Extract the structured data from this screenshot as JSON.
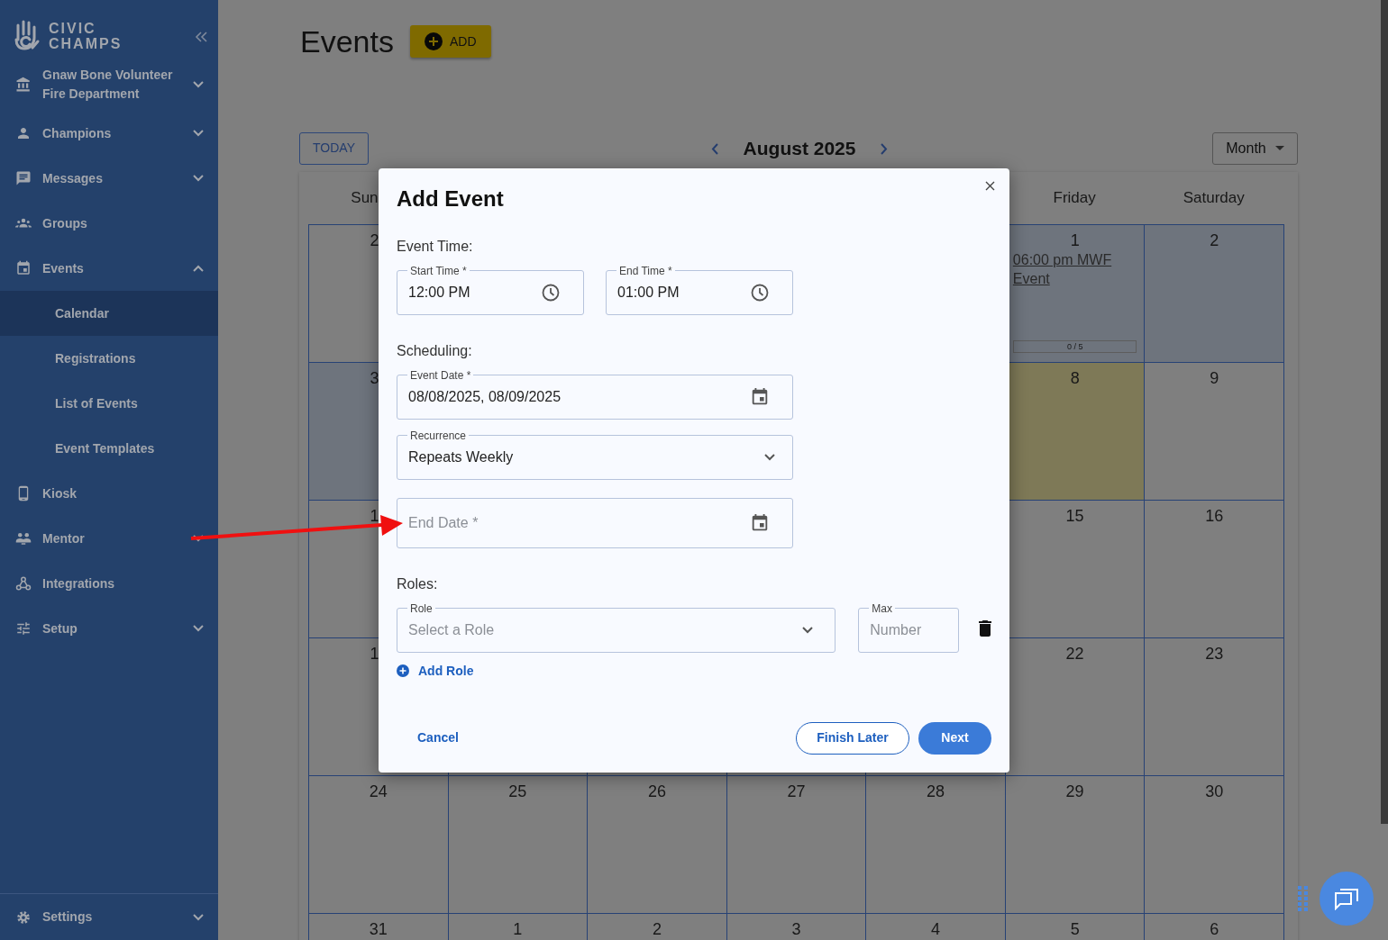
{
  "sidebar": {
    "brand": [
      "CIVIC",
      "CHAMPS"
    ],
    "items": [
      {
        "label": "Gnaw Bone Volunteer Fire Department",
        "expanded": false
      },
      {
        "label": "Champions",
        "expanded": false
      },
      {
        "label": "Messages",
        "expanded": false
      },
      {
        "label": "Groups"
      },
      {
        "label": "Events",
        "expanded": true,
        "children": [
          {
            "label": "Calendar",
            "selected": true
          },
          {
            "label": "Registrations",
            "selected": false
          },
          {
            "label": "List of Events",
            "selected": false
          },
          {
            "label": "Event Templates",
            "selected": false
          }
        ]
      },
      {
        "label": "Kiosk"
      },
      {
        "label": "Mentor",
        "expanded": false
      },
      {
        "label": "Integrations"
      },
      {
        "label": "Setup",
        "expanded": false
      }
    ],
    "footer": {
      "label": "Settings",
      "expanded": false
    }
  },
  "page": {
    "title": "Events",
    "add_button": "ADD"
  },
  "calendar": {
    "today_button": "TODAY",
    "month": "August 2025",
    "view": "Month",
    "weekdays": {
      "covered": true,
      "labels": [
        "Sun",
        "Friday",
        "Saturday"
      ]
    },
    "weeks": [
      {
        "covered": true,
        "cells": [
          {
            "day": "2",
            "cut": true,
            "highlighted": false,
            "today": false
          },
          {
            "day": "1",
            "highlighted": true,
            "today": false,
            "events": [
              {
                "title": "06:00 pm MWF Event",
                "count": "0 / 5",
                "level": 0
              }
            ]
          },
          {
            "day": "2",
            "highlighted": true,
            "today": false
          }
        ]
      },
      {
        "covered": true,
        "cells": [
          {
            "day": "3",
            "cut": true,
            "highlighted": true,
            "today": false
          },
          {
            "day": "8",
            "highlighted": false,
            "today": true
          },
          {
            "day": "9",
            "highlighted": false,
            "today": false
          }
        ]
      },
      {
        "covered": true,
        "cells": [
          {
            "day": "1",
            "cut": true,
            "highlighted": false,
            "today": false
          },
          {
            "day": "15",
            "highlighted": false,
            "today": false
          },
          {
            "day": "16",
            "highlighted": false,
            "today": false
          }
        ]
      },
      {
        "covered": true,
        "cells": [
          {
            "day": "1",
            "cut": true,
            "highlighted": false,
            "today": false
          },
          {
            "day": "22",
            "highlighted": false,
            "today": false
          },
          {
            "day": "23",
            "highlighted": false,
            "today": false
          }
        ]
      },
      {
        "cells": [
          {
            "day": "24",
            "highlighted": false,
            "today": false
          },
          {
            "day": "25",
            "highlighted": false,
            "today": false
          },
          {
            "day": "26",
            "highlighted": false,
            "today": false
          },
          {
            "day": "27",
            "highlighted": false,
            "today": false
          },
          {
            "day": "28",
            "highlighted": false,
            "today": false
          },
          {
            "day": "29",
            "highlighted": false,
            "today": false
          },
          {
            "day": "30",
            "highlighted": false,
            "today": false
          }
        ]
      },
      {
        "cells": [
          {
            "day": "31",
            "highlighted": false,
            "today": false
          },
          {
            "day": "1",
            "highlighted": false,
            "today": false
          },
          {
            "day": "2",
            "highlighted": false,
            "today": false
          },
          {
            "day": "3",
            "highlighted": false,
            "today": false
          },
          {
            "day": "4",
            "highlighted": false,
            "today": false
          },
          {
            "day": "5",
            "highlighted": false,
            "today": false
          },
          {
            "day": "6",
            "highlighted": false,
            "today": false
          }
        ]
      }
    ]
  },
  "modal": {
    "title": "Add Event",
    "sections": [
      {
        "heading": "Event Time:",
        "fields": [
          {
            "kind": "time",
            "label": "Start Time *",
            "value": "12:00 PM"
          },
          {
            "kind": "time",
            "label": "End Time *",
            "value": "01:00 PM"
          }
        ]
      },
      {
        "heading": "Scheduling:",
        "fields": [
          {
            "kind": "date",
            "label": "Event Date *",
            "value": "08/08/2025, 08/09/2025"
          },
          {
            "kind": "select",
            "label": "Recurrence",
            "value": "Repeats Weekly"
          },
          {
            "kind": "date",
            "placeholder": "End Date *"
          }
        ]
      },
      {
        "heading": "Roles:",
        "roles": [
          {
            "role": {
              "label": "Role",
              "placeholder": "Select a Role"
            },
            "max": {
              "label": "Max",
              "placeholder": "Number"
            }
          }
        ],
        "add_role": "Add Role"
      }
    ],
    "actions": {
      "cancel": "Cancel",
      "finish_later": "Finish Later",
      "next": "Next"
    }
  }
}
